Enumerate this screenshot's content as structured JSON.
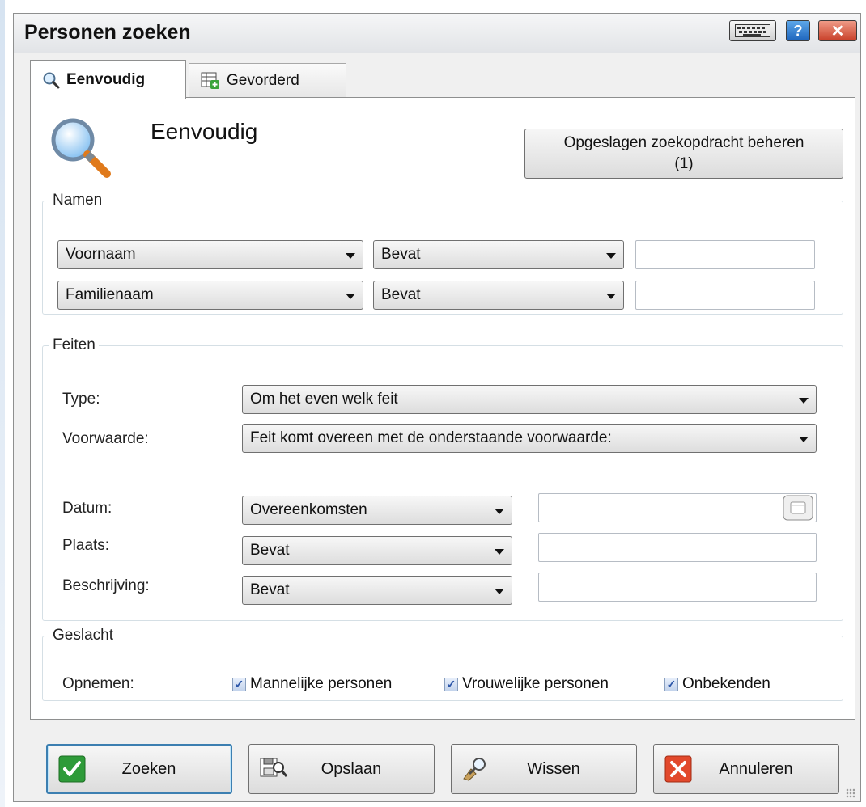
{
  "window": {
    "title": "Personen zoeken"
  },
  "tabs": [
    {
      "label": "Eenvoudig",
      "icon": "magnifier-icon",
      "active": true
    },
    {
      "label": "Gevorderd",
      "icon": "advanced-table-icon",
      "active": false
    }
  ],
  "panel": {
    "title": "Eenvoudig",
    "saved_search_button": {
      "line1": "Opgeslagen zoekopdracht beheren",
      "line2": "(1)"
    }
  },
  "names": {
    "legend": "Namen",
    "rows": [
      {
        "field": "Voornaam",
        "operator": "Bevat",
        "value": ""
      },
      {
        "field": "Familienaam",
        "operator": "Bevat",
        "value": ""
      }
    ]
  },
  "facts": {
    "legend": "Feiten",
    "type_label": "Type:",
    "type_value": "Om het even welk feit",
    "condition_label": "Voorwaarde:",
    "condition_value": "Feit komt overeen met de onderstaande voorwaarde:",
    "date_label": "Datum:",
    "date_operator": "Overeenkomsten",
    "date_value": "",
    "place_label": "Plaats:",
    "place_operator": "Bevat",
    "place_value": "",
    "description_label": "Beschrijving:",
    "description_operator": "Bevat",
    "description_value": ""
  },
  "gender": {
    "legend": "Geslacht",
    "include_label": "Opnemen:",
    "options": [
      {
        "label": "Mannelijke personen",
        "checked": true
      },
      {
        "label": "Vrouwelijke personen",
        "checked": true
      },
      {
        "label": "Onbekenden",
        "checked": true
      }
    ]
  },
  "footer": {
    "search": "Zoeken",
    "save": "Opslaan",
    "clear": "Wissen",
    "cancel": "Annuleren"
  },
  "colors": {
    "accent": "#3c7fb1",
    "close": "#c9412a",
    "ok_green": "#2e9b39"
  }
}
